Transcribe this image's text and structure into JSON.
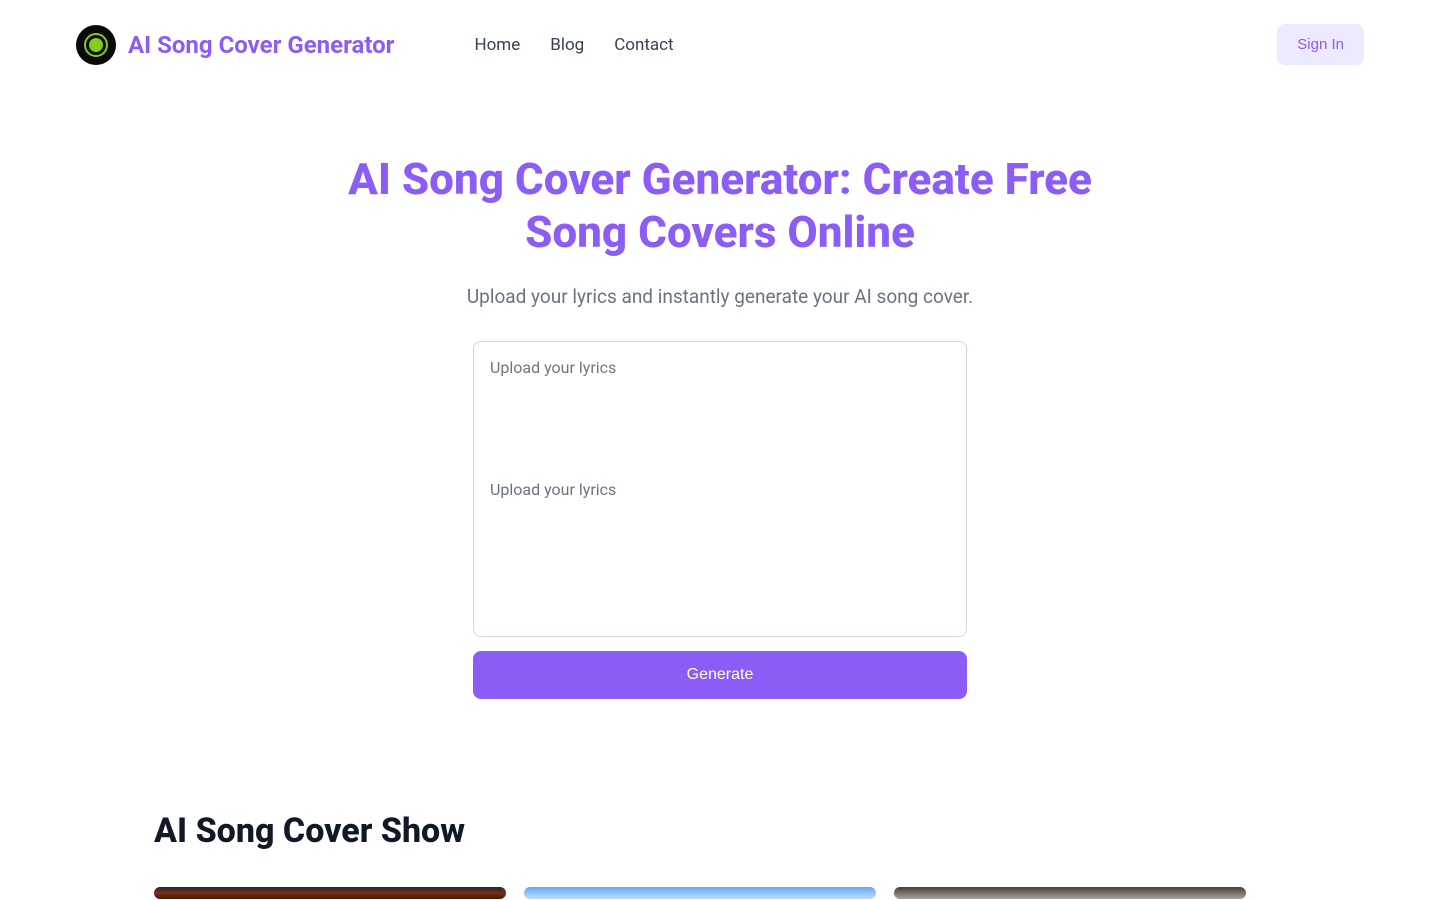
{
  "header": {
    "brand": "AI Song Cover Generator",
    "nav": {
      "home": "Home",
      "blog": "Blog",
      "contact": "Contact"
    },
    "signin": "Sign In"
  },
  "hero": {
    "title": "AI Song Cover Generator: Create Free Song Covers Online",
    "subtitle": "Upload your lyrics and instantly generate your AI song cover.",
    "placeholder": "Upload your lyrics",
    "generate": "Generate"
  },
  "showcase": {
    "title": "AI Song Cover Show"
  },
  "colors": {
    "accent": "#8b5cf6",
    "accent_light": "#ede9fe",
    "text_muted": "#6b7280"
  }
}
